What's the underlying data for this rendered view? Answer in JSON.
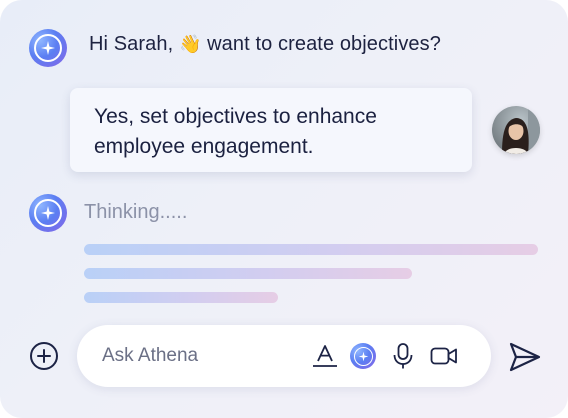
{
  "chat": {
    "greeting_text": "Hi Sarah,",
    "greeting_emoji": "👋",
    "greeting_rest": "want to create objectives?",
    "user_message": "Yes, set objectives to enhance employee engagement.",
    "thinking_text": "Thinking....."
  },
  "composer": {
    "placeholder": "Ask Athena"
  },
  "icons": {
    "bot_avatar": "athena-logo-icon",
    "user_avatar": "user-photo",
    "add": "plus-circle-icon",
    "format": "text-format-icon",
    "assistant": "athena-logo-icon",
    "mic": "microphone-icon",
    "video": "video-camera-icon",
    "send": "send-icon"
  },
  "colors": {
    "text_primary": "#1d2240",
    "text_muted": "#8c92a8",
    "accent_blue": "#5b7ef2",
    "accent_purple": "#8a63e6"
  }
}
